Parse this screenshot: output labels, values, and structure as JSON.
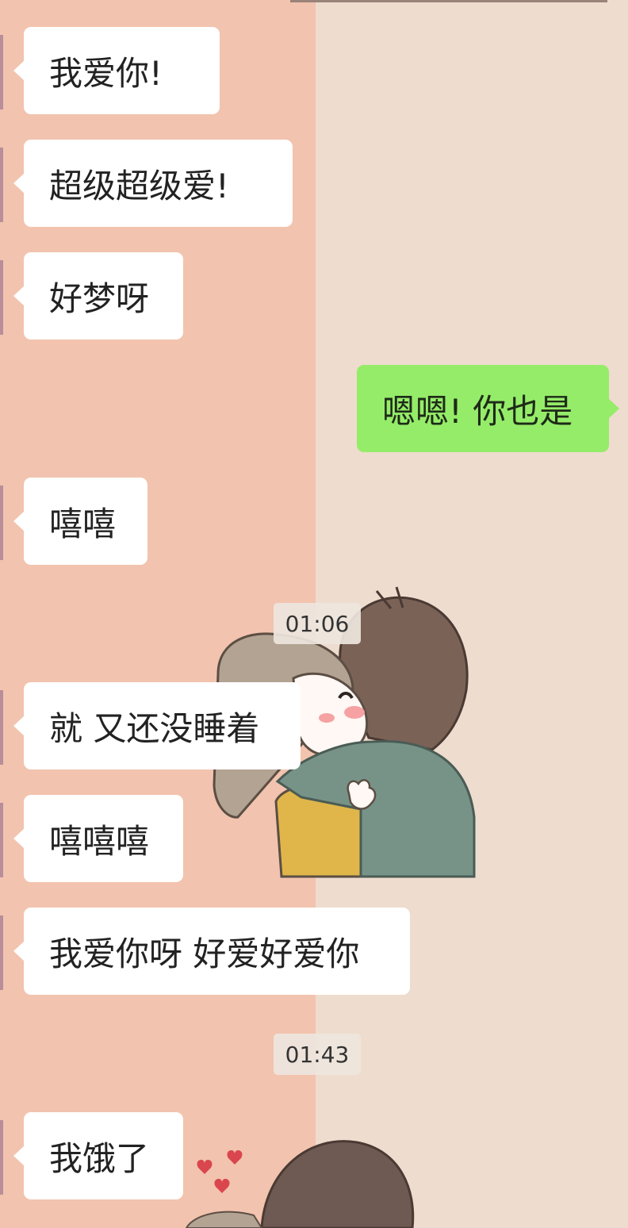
{
  "messages": [
    {
      "side": "left",
      "text": "我爱你!"
    },
    {
      "side": "left",
      "text": "超级超级爱!"
    },
    {
      "side": "left",
      "text": "好梦呀"
    },
    {
      "side": "right",
      "text": "嗯嗯! 你也是"
    },
    {
      "side": "left",
      "text": "嘻嘻"
    },
    {
      "side": "left",
      "text": "就 又还没睡着"
    },
    {
      "side": "left",
      "text": "嘻嘻嘻"
    },
    {
      "side": "left",
      "text": "我爱你呀 好爱好爱你"
    },
    {
      "side": "left",
      "text": "我饿了"
    }
  ],
  "timestamps": [
    "01:06",
    "01:43"
  ],
  "colors": {
    "background_left": "#F2C3AE",
    "background_right": "#EEDCCE",
    "incoming_bubble": "#FFFFFF",
    "outgoing_bubble": "#95EC69"
  }
}
